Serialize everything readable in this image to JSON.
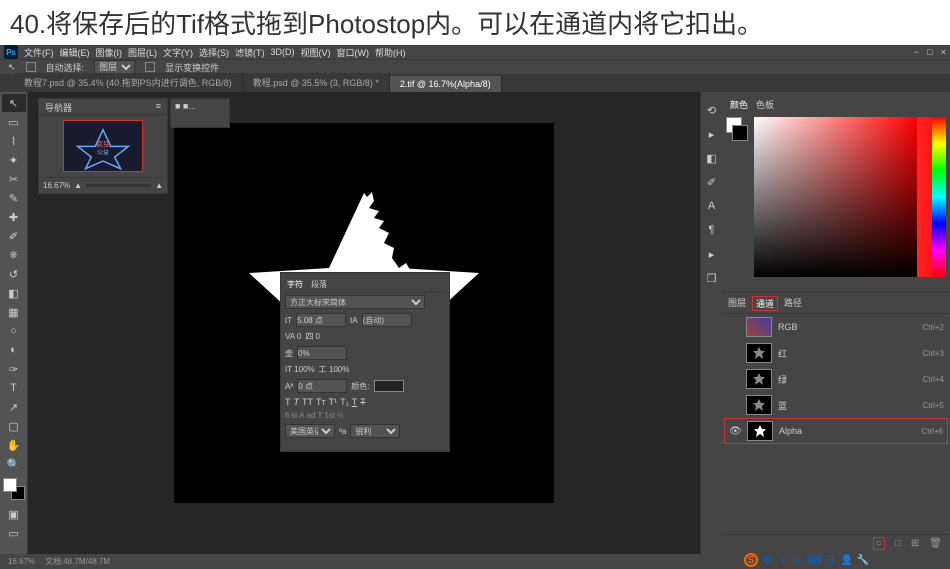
{
  "instruction": "40.将保存后的Tif格式拖到Photostop内。可以在通道内将它扣出。",
  "menu": {
    "items": [
      "文件(F)",
      "编辑(E)",
      "图像(I)",
      "图层(L)",
      "文字(Y)",
      "选择(S)",
      "滤镜(T)",
      "3D(D)",
      "视图(V)",
      "窗口(W)",
      "帮助(H)"
    ]
  },
  "options": {
    "auto_select": "自动选择:",
    "layer_type": "图层",
    "show_transform": "显示变换控件"
  },
  "tabs": [
    {
      "label": "教程7.psd @ 35.4% (40.拖到PS内进行调色, RGB/8)",
      "active": false
    },
    {
      "label": "教程.psd @ 35.5% (3, RGB/8) *",
      "active": false
    },
    {
      "label": "2.tif @ 16.7%(Alpha/8)",
      "active": true
    }
  ],
  "navigator": {
    "title": "导航器",
    "zoom": "16.67%"
  },
  "nav_side": "■ ■...",
  "color_panel": {
    "tab1": "颜色",
    "tab2": "色板"
  },
  "char_panel": {
    "tab1": "字符",
    "tab2": "段落",
    "font": "方正大标宋简体",
    "size": "5.08 点",
    "leading": "(自动)",
    "va": "VA 0",
    "tracking": "四 0",
    "scale_a": "0%",
    "scale_t": "IT 100%",
    "scale_w": "工 100%",
    "baseline": "0 点",
    "color_label": "颜色:",
    "lang": "美国英语",
    "crisp": "锐利"
  },
  "channels": {
    "tab_layers": "图层",
    "tab_channels": "通道",
    "tab_paths": "路径",
    "items": [
      {
        "name": "RGB",
        "shortcut": "Ctrl+2",
        "visible": false
      },
      {
        "name": "红",
        "shortcut": "Ctrl+3",
        "visible": false
      },
      {
        "name": "绿",
        "shortcut": "Ctrl+4",
        "visible": false
      },
      {
        "name": "蓝",
        "shortcut": "Ctrl+5",
        "visible": false
      },
      {
        "name": "Alpha",
        "shortcut": "Ctrl+6",
        "visible": true
      }
    ]
  },
  "status": {
    "zoom": "16.67%",
    "doc": "文档:48.7M/48.7M"
  },
  "ime": "中"
}
